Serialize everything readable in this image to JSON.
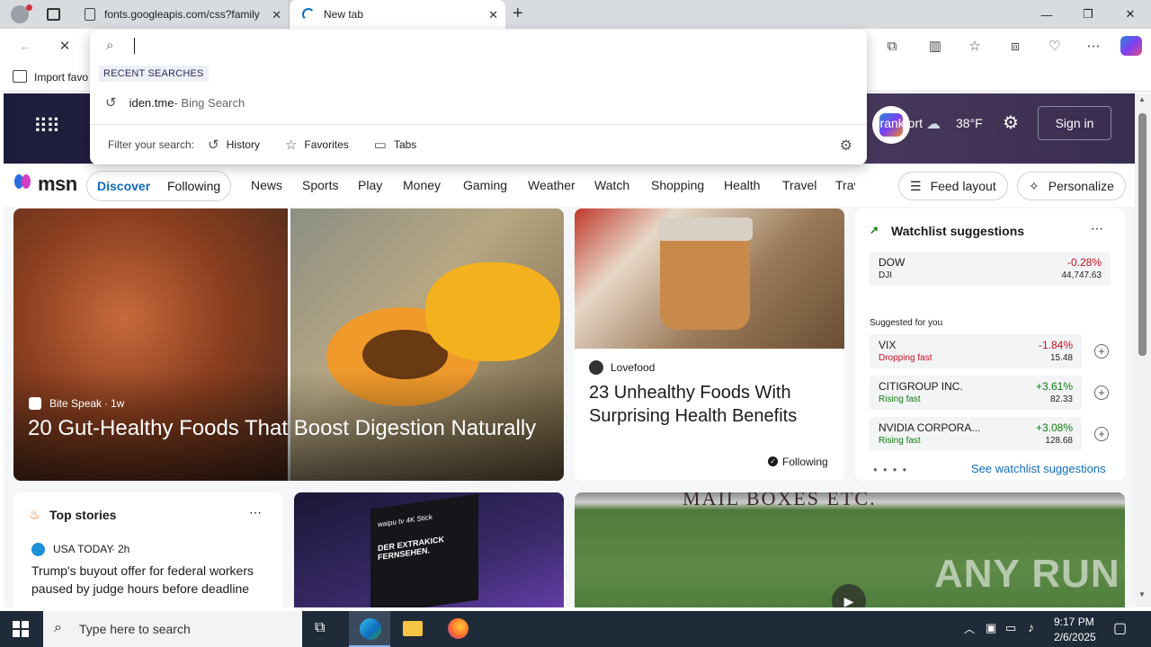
{
  "tabs": [
    {
      "label": "fonts.googleapis.com/css?family",
      "icon": "page-icon"
    },
    {
      "label": "New tab",
      "icon": "loading-icon"
    }
  ],
  "favorites_bar": {
    "import_label": "Import favo"
  },
  "search_dropdown": {
    "input_value": "",
    "recent_header": "RECENT SEARCHES",
    "recent": [
      {
        "query": "iden.tme",
        "suffix": " - Bing Search"
      }
    ],
    "filter_label": "Filter your search:",
    "filters": [
      "History",
      "Favorites",
      "Tabs"
    ]
  },
  "banner": {
    "location": "Frankfort",
    "temperature": "38°F",
    "sign_in": "Sign in"
  },
  "msn": {
    "logo": "msn",
    "feed_tabs": [
      "Discover",
      "Following"
    ],
    "nav": [
      "News",
      "Sports",
      "Play",
      "Money",
      "Gaming",
      "Weather",
      "Watch",
      "Shopping",
      "Health",
      "Travel",
      "Trav"
    ],
    "feed_layout": "Feed layout",
    "personalize": "Personalize"
  },
  "hero": {
    "source": "Bite Speak",
    "age": "1w",
    "headline": "20 Gut-Healthy Foods That Boost Digestion Naturally"
  },
  "card2": {
    "source": "Lovefood",
    "headline": "23 Unhealthy Foods With Surprising Health Benefits",
    "following": "Following"
  },
  "watchlist": {
    "title": "Watchlist suggestions",
    "index": {
      "symbol": "DOW",
      "sub": "DJI",
      "change": "-0.28%",
      "price": "44,747.63"
    },
    "suggested_label": "Suggested for you",
    "items": [
      {
        "symbol": "VIX",
        "sub": "Dropping fast",
        "change": "-1.84%",
        "price": "15.48"
      },
      {
        "symbol": "CITIGROUP INC.",
        "sub": "Rising fast",
        "change": "+3.61%",
        "price": "82.33"
      },
      {
        "symbol": "NVIDIA CORPORA...",
        "sub": "Rising fast",
        "change": "+3.08%",
        "price": "128.68"
      }
    ],
    "see_more": "See watchlist suggestions"
  },
  "top_stories": {
    "title": "Top stories",
    "source": "USA TODAY",
    "age": "2h",
    "headline": "Trump's buyout offer for federal workers paused by judge hours before deadline"
  },
  "promo": {
    "brand": "waipu tv 4K Stick",
    "tagline": "DER EXTRAKICK FERNSEHEN."
  },
  "video": {
    "signage": "MAIL BOXES ETC.",
    "watermark": "ANY RUN"
  },
  "taskbar": {
    "search_placeholder": "Type here to search",
    "time": "9:17 PM",
    "date": "2/6/2025"
  },
  "colors": {
    "accent": "#0f6cbd",
    "negative": "#c50f1f",
    "positive": "#0e7a0d",
    "taskbar": "#1f2b38"
  }
}
